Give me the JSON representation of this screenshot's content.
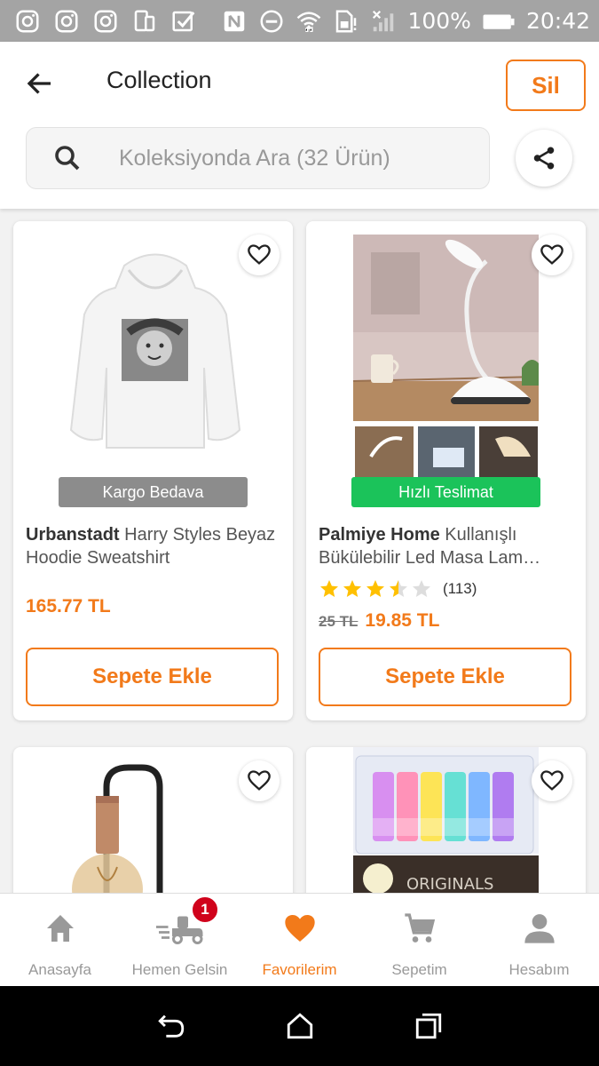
{
  "status_bar": {
    "battery": "100%",
    "time": "20:42",
    "icons": [
      "instagram-icon",
      "instagram-icon",
      "instagram-icon",
      "devices-icon",
      "checkbox-icon",
      "nfc-icon",
      "do-not-disturb-icon",
      "wifi-icon",
      "sim-alert-icon",
      "no-signal-icon",
      "battery-icon"
    ]
  },
  "header": {
    "title": "Collection",
    "delete_label": "Sil",
    "search_placeholder": "Koleksiyonda Ara (32 Ürün)"
  },
  "products": [
    {
      "brand": "Urbanstadt",
      "name": " Harry Styles Beyaz Hoodie Sweatshirt",
      "badge": "Kargo Bedava",
      "badge_color": "#8c8c8c",
      "price": "165.77 TL",
      "add_label": "Sepete Ekle"
    },
    {
      "brand": "Palmiye Home",
      "name": " Kullanışlı Bükülebilir Led Masa Lam…",
      "badge": "Hızlı Teslimat",
      "badge_color": "#1bc35a",
      "rating": 3.5,
      "rating_count": "(113)",
      "old_price": "25 TL",
      "price": "19.85 TL",
      "add_label": "Sepete Ekle"
    }
  ],
  "bottom_nav": {
    "items": [
      {
        "label": "Anasayfa",
        "icon": "home-icon"
      },
      {
        "label": "Hemen Gelsin",
        "icon": "delivery-scooter-icon",
        "badge": "1"
      },
      {
        "label": "Favorilerim",
        "icon": "heart-icon",
        "active": true
      },
      {
        "label": "Sepetim",
        "icon": "cart-icon"
      },
      {
        "label": "Hesabım",
        "icon": "user-icon"
      }
    ]
  },
  "colors": {
    "accent": "#f27a1a",
    "free_shipping": "#8c8c8c",
    "fast_delivery": "#1bc35a",
    "badge_red": "#d0021b"
  }
}
